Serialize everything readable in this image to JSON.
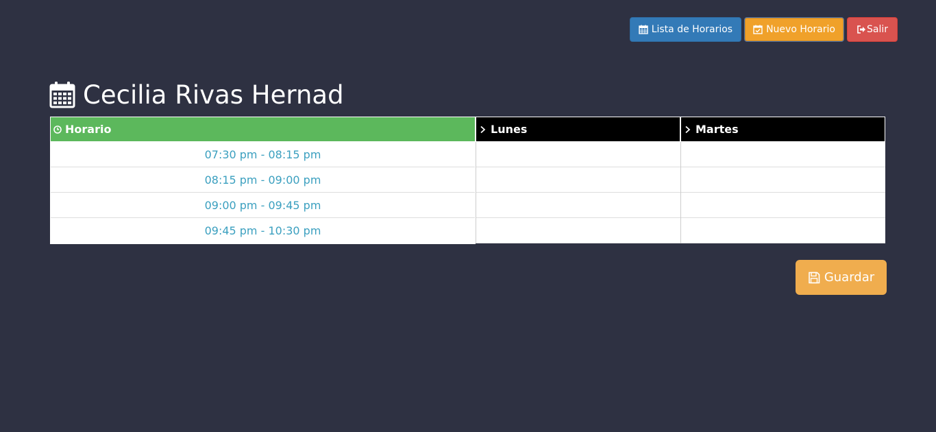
{
  "nav": {
    "list_label": "Lista de Horarios",
    "new_label": "Nuevo Horario",
    "exit_label": "Salir"
  },
  "page": {
    "title": "Cecilia Rivas Hernad"
  },
  "table": {
    "headers": {
      "time": "Horario",
      "days": [
        "Lunes",
        "Martes"
      ]
    },
    "time_slots": [
      "07:30 pm - 08:15 pm",
      "08:15 pm - 09:00 pm",
      "09:00 pm - 09:45 pm",
      "09:45 pm - 10:30 pm"
    ]
  },
  "actions": {
    "save_label": "Guardar"
  },
  "colors": {
    "background": "#2e3142",
    "primary": "#337ab7",
    "warning": "#f0a12a",
    "danger": "#d9534f",
    "header_green": "#5cb85c",
    "slot_text": "#3a9fbf"
  }
}
